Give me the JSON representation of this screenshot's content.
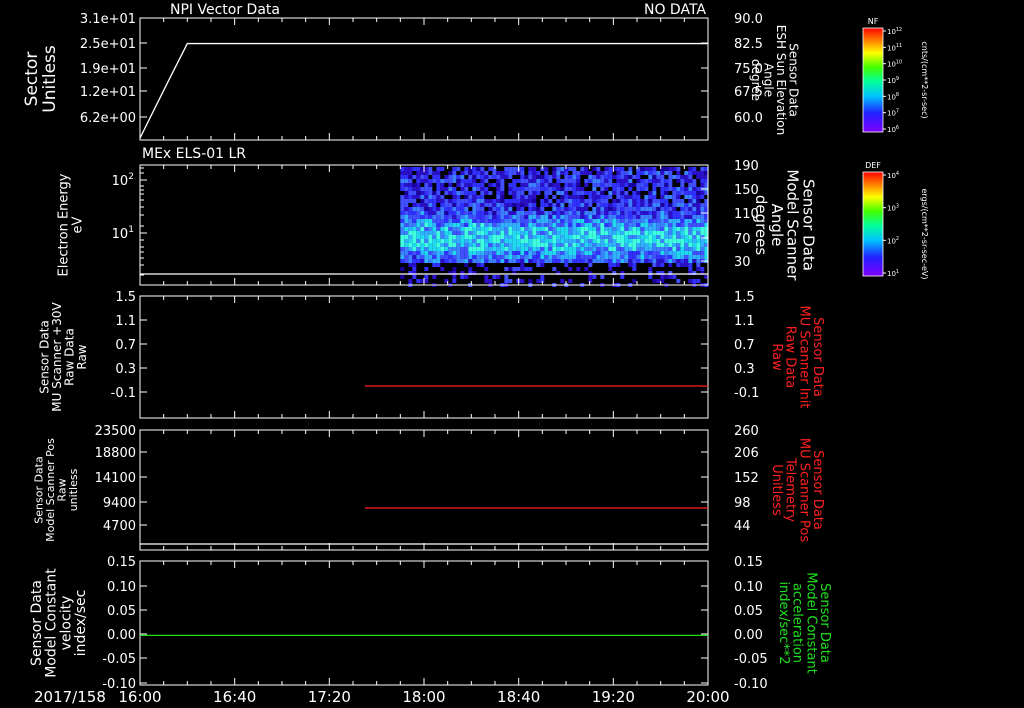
{
  "date_label": "2017/158",
  "x_axis": {
    "tick_labels": [
      "16:00",
      "16:40",
      "17:20",
      "18:00",
      "18:40",
      "19:20",
      "20:00"
    ]
  },
  "colorbars": [
    {
      "tag": "NF",
      "unit": "cnts/(cm**2-sr-sec)",
      "tick_labels": [
        "10^12",
        "10^11",
        "10^10",
        "10^9",
        "10^8",
        "10^7",
        "10^6"
      ]
    },
    {
      "tag": "DEF",
      "unit": "ergs/(cm**2-sr-sec-eV)",
      "tick_labels": [
        "10^4",
        "10^3",
        "10^2",
        "10^1"
      ]
    }
  ],
  "chart_data": [
    {
      "type": "line",
      "title": "NPI Vector Data",
      "status": "NO DATA",
      "ylabel_left": [
        "Sector",
        "Unitless"
      ],
      "ylabel_right": [
        "Sensor Data",
        "ESH Sun Elevation",
        "Angle",
        "degree"
      ],
      "left_ticks": [
        "3.1e+01",
        "2.5e+01",
        "1.9e+01",
        "1.2e+01",
        "6.2e+00"
      ],
      "right_ticks": [
        "90.0",
        "82.5",
        "75.0",
        "67.5",
        "60.0"
      ],
      "ylim": [
        0,
        31
      ],
      "series": [
        {
          "color": "#ffffff",
          "x": [
            "16:00",
            "16:12",
            "16:20",
            "20:00"
          ],
          "y": [
            0.5,
            15,
            24.5,
            24.5
          ]
        }
      ]
    },
    {
      "type": "heatmap",
      "title": "MEx ELS-01 LR",
      "ylabel_left": [
        "Electron Energy",
        "eV"
      ],
      "ylabel_right": [
        "Sensor Data",
        "Model Scanner",
        "Angle",
        "degrees"
      ],
      "left_ticks": [
        "10^2",
        "10^1"
      ],
      "right_ticks": [
        "190",
        "150",
        "110",
        "70",
        "30"
      ],
      "yscale": "log",
      "data_start": "17:50",
      "data_end": "20:00",
      "colorbar": "DEF",
      "line_series": {
        "color": "#ffffff",
        "x": [
          "16:00",
          "20:00"
        ],
        "y_right": [
          0,
          0
        ]
      }
    },
    {
      "type": "line",
      "ylabel_left": [
        "Sensor Data",
        "MU Scanner +30V",
        "Raw Data",
        "Raw"
      ],
      "ylabel_right": [
        "Sensor Data",
        "MU Scanner Init",
        "Raw Data",
        "Raw"
      ],
      "right_label_color": "#ff2020",
      "left_ticks": [
        "1.5",
        "1.1",
        "0.7",
        "0.3",
        "-0.1"
      ],
      "right_ticks": [
        "1.5",
        "1.1",
        "0.7",
        "0.3",
        "-0.1"
      ],
      "ylim": [
        -0.5,
        1.5
      ],
      "series": [
        {
          "color": "#ff2020",
          "x": [
            "17:35",
            "20:00"
          ],
          "y": [
            -0.0,
            -0.0
          ]
        }
      ]
    },
    {
      "type": "line",
      "ylabel_left": [
        "Sensor Data",
        "Model Scanner Pos",
        "Raw",
        "unitless"
      ],
      "ylabel_right": [
        "Sensor Data",
        "MU Scanner Pos",
        "Telemetry",
        "Unitless"
      ],
      "right_label_color": "#ff2020",
      "left_ticks": [
        "23500",
        "18800",
        "14100",
        "9400",
        "4700"
      ],
      "right_ticks": [
        "260",
        "206",
        "152",
        "98",
        "44"
      ],
      "ylim": [
        0,
        23500
      ],
      "series": [
        {
          "color": "#ff2020",
          "x": [
            "17:35",
            "20:00"
          ],
          "y": [
            8300,
            8300
          ]
        },
        {
          "color": "#ffffff",
          "x": [
            "16:00",
            "20:00"
          ],
          "y": [
            0,
            0
          ]
        }
      ]
    },
    {
      "type": "line",
      "ylabel_left": [
        "Sensor Data",
        "Model Constant",
        "velocity",
        "index/sec"
      ],
      "ylabel_right": [
        "Sensor Data",
        "Model Constant",
        "acceleration",
        "index/sec**2"
      ],
      "right_label_color": "#20e020",
      "left_ticks": [
        "0.15",
        "0.10",
        "0.05",
        "0.00",
        "-0.05",
        "-0.10"
      ],
      "right_ticks": [
        "0.15",
        "0.10",
        "0.05",
        "0.00",
        "-0.05",
        "-0.10"
      ],
      "ylim": [
        -0.1,
        0.15
      ],
      "series": [
        {
          "color": "#20e020",
          "x": [
            "16:00",
            "20:00"
          ],
          "y": [
            0,
            0
          ]
        }
      ]
    }
  ]
}
